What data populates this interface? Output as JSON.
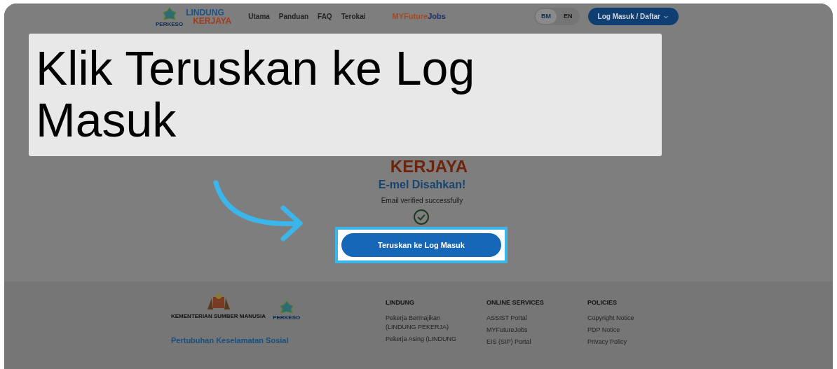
{
  "header": {
    "logo_top": "LINDUNG",
    "logo_bottom": "KERJAYA",
    "logo_caption": "PERKESO",
    "nav": [
      {
        "label": "Utama"
      },
      {
        "label": "Panduan"
      },
      {
        "label": "FAQ"
      },
      {
        "label": "Terokai"
      }
    ],
    "partner_logo": {
      "part1": "MYFuture",
      "part2": "Jobs"
    },
    "languages": [
      {
        "label": "BM",
        "selected": true
      },
      {
        "label": "EN",
        "selected": false
      }
    ],
    "login_button": "Log Masuk / Daftar"
  },
  "caption": "Klik Teruskan ke Log Masuk",
  "main": {
    "logo_bottom": "KERJAYA",
    "heading": "E-mel Disahkan!",
    "message": "Email verified successfully",
    "button": "Teruskan ke Log Masuk"
  },
  "footer": {
    "ministry": "KEMENTERIAN SUMBER MANUSIA",
    "agency_logo": "PERKESO",
    "org_name": "Pertubuhan Keselamatan Sosial",
    "columns": [
      {
        "title": "LINDUNG",
        "links": [
          "Pekerja Bermajikan (LINDUNG PEKERJA)",
          "Pekerja Asing (LINDUNG"
        ]
      },
      {
        "title": "ONLINE SERVICES",
        "links": [
          "ASSIST Portal",
          "MYFutureJobs",
          "EIS (SIP) Portal"
        ]
      },
      {
        "title": "POLICIES",
        "links": [
          "Copyright Notice",
          "PDP Notice",
          "Privacy Policy"
        ]
      }
    ]
  }
}
